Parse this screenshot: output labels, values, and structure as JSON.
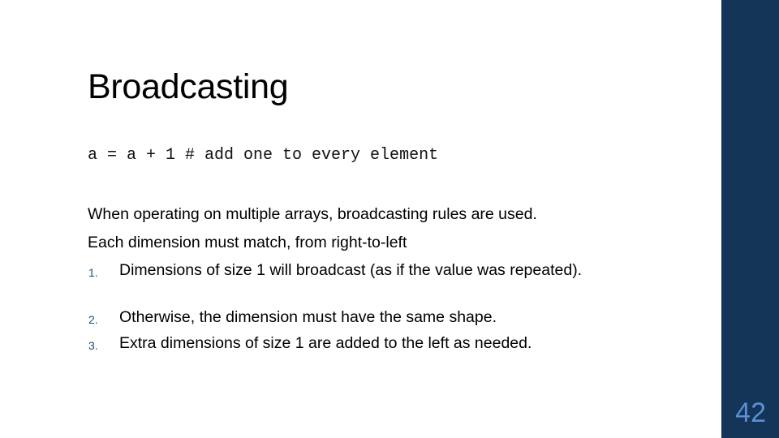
{
  "slide": {
    "title": "Broadcasting",
    "code_line": "a = a + 1 # add one to every element",
    "paragraphs": [
      "When operating on multiple arrays, broadcasting rules are used.",
      "Each dimension must match, from right-to-left"
    ],
    "rules": [
      {
        "number": "1.",
        "text": "Dimensions of size 1 will broadcast (as if the value was repeated)."
      },
      {
        "number": "2.",
        "text": "Otherwise, the dimension must have the same shape."
      },
      {
        "number": "3.",
        "text": "Extra dimensions of size 1 are added to the left as needed."
      }
    ],
    "page_number": "42"
  },
  "colors": {
    "side_bar": "#143458",
    "page_number": "#5b8fd6",
    "list_number": "#1f4e79"
  }
}
